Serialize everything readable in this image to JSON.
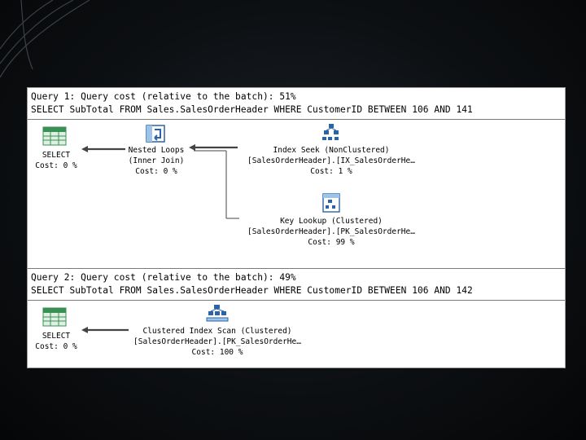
{
  "query1": {
    "header": "Query 1: Query cost (relative to the batch): 51%",
    "sql": "SELECT SubTotal FROM Sales.SalesOrderHeader WHERE CustomerID BETWEEN 106 AND 141",
    "select": {
      "name": "SELECT",
      "cost": "Cost: 0 %"
    },
    "nested_loops": {
      "name": "Nested Loops",
      "join": "(Inner Join)",
      "cost": "Cost: 0 %"
    },
    "index_seek": {
      "name": "Index Seek (NonClustered)",
      "object": "[SalesOrderHeader].[IX_SalesOrderHe…",
      "cost": "Cost: 1 %"
    },
    "key_lookup": {
      "name": "Key Lookup (Clustered)",
      "object": "[SalesOrderHeader].[PK_SalesOrderHe…",
      "cost": "Cost: 99 %"
    }
  },
  "query2": {
    "header": "Query 2: Query cost (relative to the batch): 49%",
    "sql": "SELECT SubTotal FROM Sales.SalesOrderHeader WHERE CustomerID BETWEEN 106 AND 142",
    "select": {
      "name": "SELECT",
      "cost": "Cost: 0 %"
    },
    "index_scan": {
      "name": "Clustered Index Scan (Clustered)",
      "object": "[SalesOrderHeader].[PK_SalesOrderHe…",
      "cost": "Cost: 100 %"
    }
  },
  "colors": {
    "panel": "#ffffff",
    "background": "#0d1013",
    "icon_green": "#3a8f55",
    "icon_blue": "#2b63a8"
  }
}
